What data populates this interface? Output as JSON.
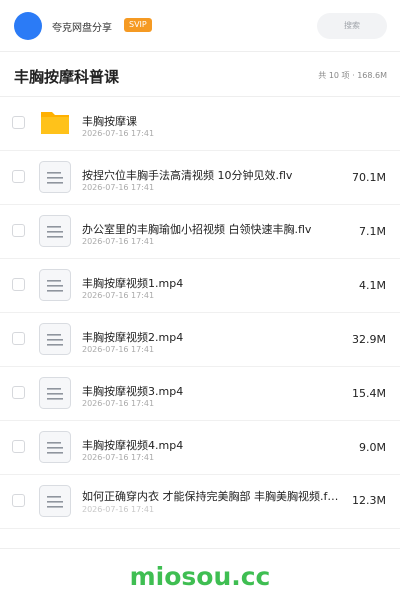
{
  "header": {
    "username": "夸克网盘分享",
    "vip_badge": "SVIP",
    "search_placeholder": "搜索"
  },
  "folder": {
    "title": "丰胸按摩科普课",
    "summary": "共 10 项 · 168.6M"
  },
  "files": [
    {
      "type": "folder",
      "name": "丰胸按摩课",
      "date": "2026-07-16 17:41",
      "size": ""
    },
    {
      "type": "file",
      "name": "按捏穴位丰胸手法高清视频  10分钟见效.flv",
      "date": "2026-07-16 17:41",
      "size": "70.1M"
    },
    {
      "type": "file",
      "name": "办公室里的丰胸瑜伽小招视频 白领快速丰胸.flv",
      "date": "2026-07-16 17:41",
      "size": "7.1M"
    },
    {
      "type": "file",
      "name": "丰胸按摩视频1.mp4",
      "date": "2026-07-16 17:41",
      "size": "4.1M"
    },
    {
      "type": "file",
      "name": "丰胸按摩视频2.mp4",
      "date": "2026-07-16 17:41",
      "size": "32.9M"
    },
    {
      "type": "file",
      "name": "丰胸按摩视频3.mp4",
      "date": "2026-07-16 17:41",
      "size": "15.4M"
    },
    {
      "type": "file",
      "name": "丰胸按摩视频4.mp4",
      "date": "2026-07-16 17:41",
      "size": "9.0M"
    },
    {
      "type": "file",
      "name": "如何正确穿内衣 才能保持完美胸部 丰胸美胸视频.f…",
      "date": "2026-07-16 17:41",
      "size": "12.3M"
    }
  ],
  "watermark": "miosou.cc",
  "colors": {
    "avatar": "#2b7bf6",
    "vip": "#f59a23",
    "folder": "#ffc21a",
    "watermark": "#3fbe52"
  }
}
